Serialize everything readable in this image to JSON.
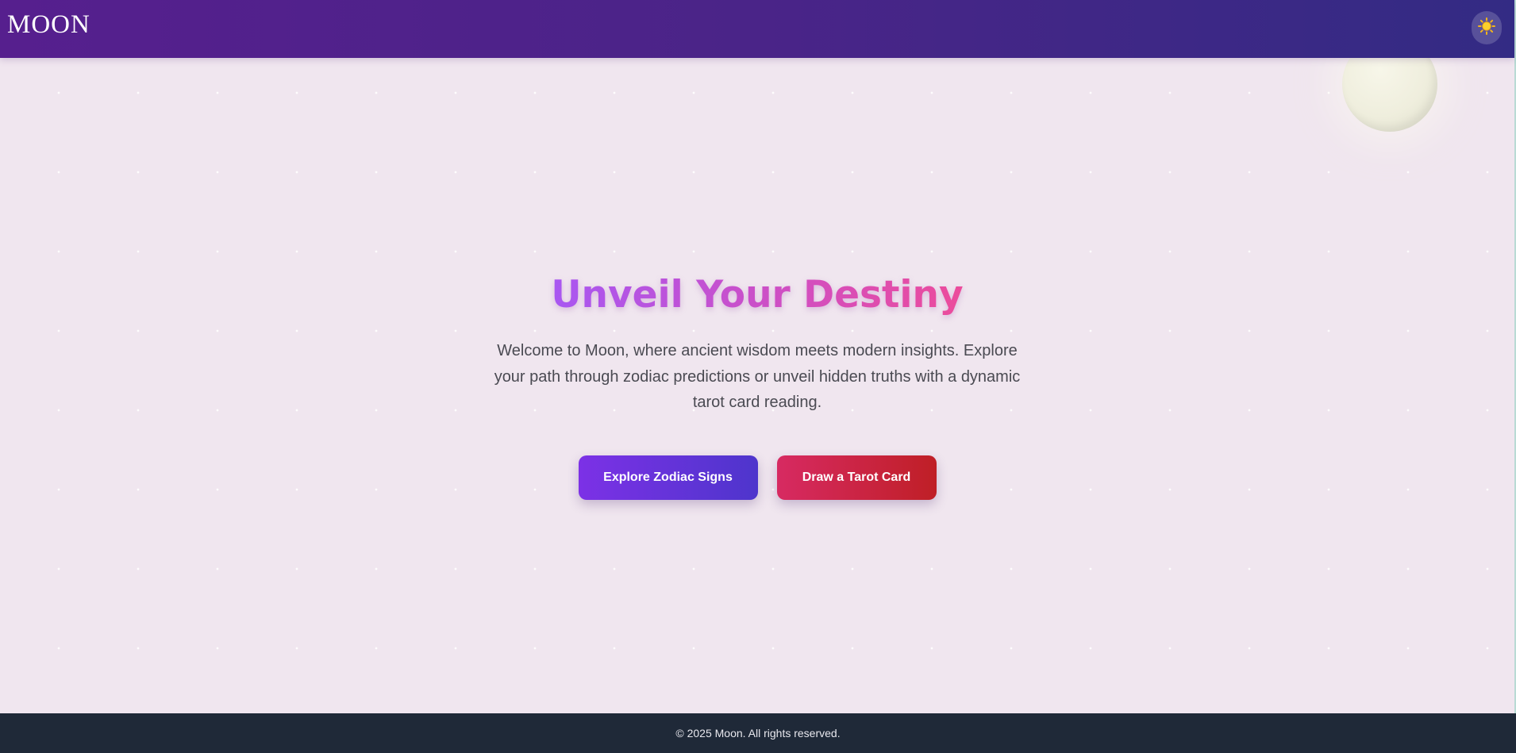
{
  "header": {
    "logo_text": "MOON",
    "theme_toggle_icon": "sun-icon"
  },
  "hero": {
    "title": "Unveil Your Destiny",
    "description": "Welcome to Moon, where ancient wisdom meets modern insights. Explore your path through zodiac predictions or unveil hidden truths with a dynamic tarot card reading.",
    "buttons": {
      "zodiac_label": "Explore Zodiac Signs",
      "tarot_label": "Draw a Tarot Card"
    }
  },
  "footer": {
    "copyright": "© 2025 Moon. All rights reserved."
  },
  "colors": {
    "header_start": "#561f8e",
    "header_end": "#332b84",
    "page_background": "#f0e6ef",
    "title_gradient_start": "#a857f2",
    "title_gradient_end": "#ec4c9b",
    "zodiac_button": "#7c31e6",
    "tarot_button": "#d72a62",
    "footer_background": "#1f2938"
  }
}
